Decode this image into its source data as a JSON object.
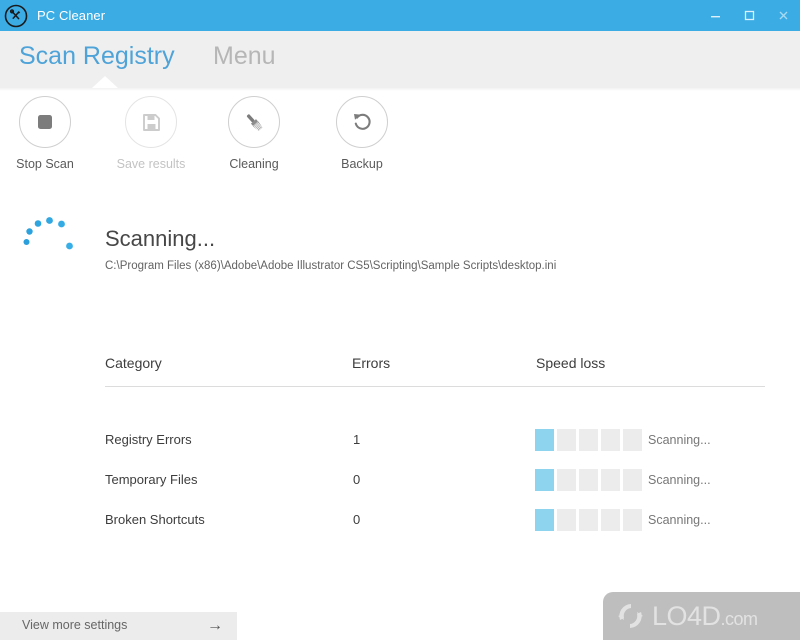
{
  "window": {
    "title": "PC Cleaner",
    "app_icon": "wrench-circle-icon",
    "accent_color": "#3bace4",
    "controls": {
      "minimize": "minimize-icon",
      "maximize": "maximize-icon",
      "close": "close-icon"
    }
  },
  "tabs": [
    {
      "label": "Scan Registry",
      "active": true
    },
    {
      "label": "Menu",
      "active": false
    }
  ],
  "toolbar": [
    {
      "label": "Stop Scan",
      "icon": "stop-square-icon",
      "enabled": true
    },
    {
      "label": "Save results",
      "icon": "floppy-save-icon",
      "enabled": false
    },
    {
      "label": "Cleaning",
      "icon": "brush-icon",
      "enabled": true
    },
    {
      "label": "Backup",
      "icon": "restore-arrow-icon",
      "enabled": true
    }
  ],
  "scan": {
    "spinner_icon": "loading-dots-spinner-icon",
    "status": "Scanning...",
    "current_path": "C:\\Program Files (x86)\\Adobe\\Adobe Illustrator CS5\\Scripting\\Sample Scripts\\desktop.ini"
  },
  "results": {
    "columns": [
      "Category",
      "Errors",
      "Speed loss"
    ],
    "rows": [
      {
        "category": "Registry Errors",
        "errors": "1",
        "speed_loss_filled": 1,
        "speed_loss_total": 5,
        "state": "Scanning..."
      },
      {
        "category": "Temporary Files",
        "errors": "0",
        "speed_loss_filled": 1,
        "speed_loss_total": 5,
        "state": "Scanning..."
      },
      {
        "category": "Broken Shortcuts",
        "errors": "0",
        "speed_loss_filled": 1,
        "speed_loss_total": 5,
        "state": "Scanning..."
      }
    ]
  },
  "footer": {
    "settings_label": "View more settings",
    "settings_arrow": "→"
  },
  "watermark": {
    "text": "LO4D",
    "suffix": ".com",
    "logo_icon": "recycle-arrows-icon"
  }
}
